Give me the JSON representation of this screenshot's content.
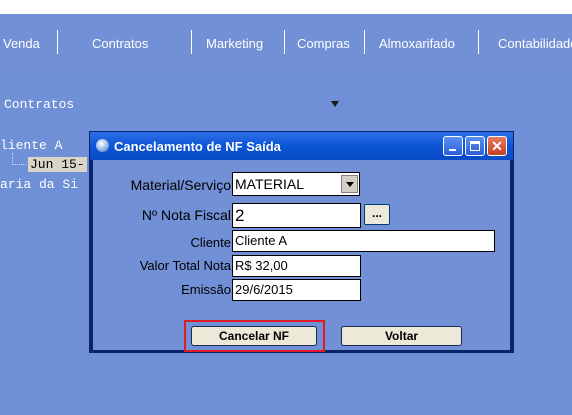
{
  "menu": {
    "items": [
      {
        "label": "Venda"
      },
      {
        "label": "Contratos"
      },
      {
        "label": "Marketing"
      },
      {
        "label": "Compras"
      },
      {
        "label": "Almoxarifado"
      },
      {
        "label": "Contabilidade"
      }
    ]
  },
  "background": {
    "title": "Contratos",
    "tree_client": "liente A",
    "tree_date": "Jun 15-",
    "tree_desc": "aria da Si"
  },
  "dialog": {
    "title": "Cancelamento de NF Saída",
    "close_glyph": "✕",
    "fields": {
      "material_label": "Material/Serviço",
      "material_value": "MATERIAL",
      "nota_label": "Nº Nota Fiscal",
      "nota_value": "2",
      "ellipsis_label": "...",
      "cliente_label": "Cliente",
      "cliente_value": "Cliente A",
      "valor_label": "Valor Total Nota",
      "valor_value": "R$ 32,00",
      "emissao_label": "Emissão",
      "emissao_value": "29/6/2015"
    },
    "buttons": {
      "cancelar": "Cancelar NF",
      "voltar": "Voltar"
    }
  },
  "colors": {
    "background": "#6f8fd6",
    "titlebar": "#0b55d6",
    "highlight": "#e01b24"
  }
}
